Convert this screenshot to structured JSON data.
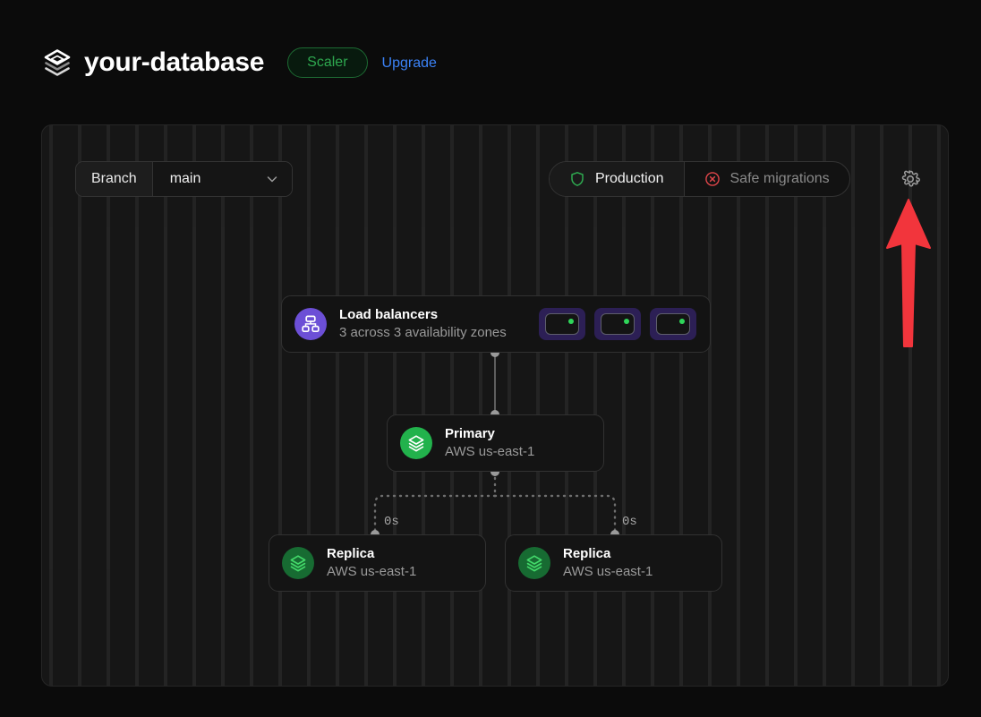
{
  "header": {
    "logo_icon": "layers-logo-icon",
    "database_name": "your-database",
    "plan_badge": "Scaler",
    "upgrade_link": "Upgrade"
  },
  "toolbar": {
    "branch_label": "Branch",
    "branch_value": "main",
    "branch_chevron_icon": "chevron-down-icon",
    "production": {
      "label": "Production",
      "icon": "shield-icon",
      "icon_color": "#2ea84f",
      "active": true
    },
    "safe_migrations": {
      "label": "Safe migrations",
      "icon": "circle-x-icon",
      "icon_color": "#e0464a",
      "active": false
    },
    "settings_icon": "gear-icon"
  },
  "topology": {
    "load_balancers": {
      "icon": "network-topology-icon",
      "icon_bg": "#6c4fd6",
      "title": "Load balancers",
      "subtitle": "3 across 3 availability zones",
      "slots": [
        {
          "status": "healthy",
          "status_color": "#2fd65a"
        },
        {
          "status": "healthy",
          "status_color": "#2fd65a"
        },
        {
          "status": "healthy",
          "status_color": "#2fd65a"
        }
      ]
    },
    "primary": {
      "icon": "layers-icon",
      "icon_bg": "#22b24c",
      "title": "Primary",
      "subtitle": "AWS us-east-1"
    },
    "replicas": [
      {
        "icon": "layers-icon",
        "icon_bg": "#176b32",
        "title": "Replica",
        "subtitle": "AWS us-east-1",
        "lag": "0s"
      },
      {
        "icon": "layers-icon",
        "icon_bg": "#176b32",
        "title": "Replica",
        "subtitle": "AWS us-east-1",
        "lag": "0s"
      }
    ]
  },
  "annotation": {
    "arrow_icon": "up-arrow-annotation",
    "arrow_color": "#f2353c",
    "points_at": "settings-gear-button"
  }
}
